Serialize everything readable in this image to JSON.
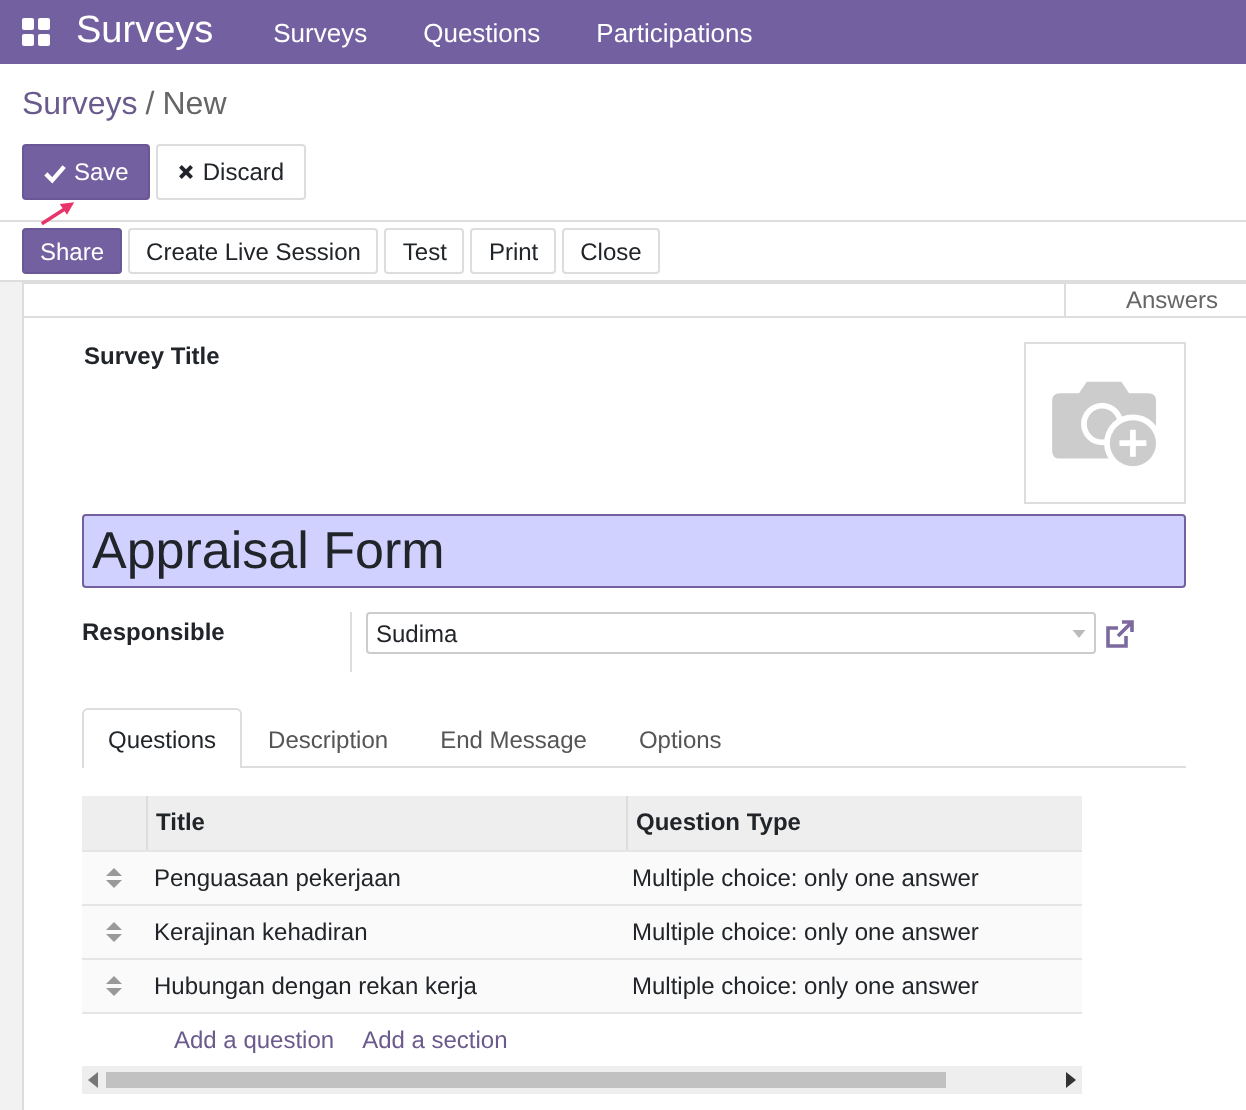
{
  "navbar": {
    "app": "Surveys",
    "menu": [
      {
        "label": "Surveys"
      },
      {
        "label": "Questions"
      },
      {
        "label": "Participations"
      }
    ]
  },
  "breadcrumb": {
    "parent": "Surveys",
    "separator": "/",
    "current": "New"
  },
  "actions": [
    {
      "label": "Save",
      "kind": "primary"
    },
    {
      "label": "Discard",
      "kind": "secondary"
    }
  ],
  "header_buttons": [
    {
      "label": "Share",
      "kind": "primary"
    },
    {
      "label": "Create Live Session",
      "kind": "secondary"
    },
    {
      "label": "Test",
      "kind": "secondary"
    },
    {
      "label": "Print",
      "kind": "secondary"
    },
    {
      "label": "Close",
      "kind": "secondary"
    }
  ],
  "smart_button": {
    "label": "Answers"
  },
  "form": {
    "title_label": "Survey Title",
    "title_value": "Appraisal Form",
    "responsible_label": "Responsible",
    "responsible_value": "Sudima"
  },
  "tabs": [
    {
      "label": "Questions",
      "selected": true
    },
    {
      "label": "Description",
      "selected": false
    },
    {
      "label": "End Message",
      "selected": false
    },
    {
      "label": "Options",
      "selected": false
    }
  ],
  "table": {
    "columns": [
      "Title",
      "Question Type"
    ],
    "rows": [
      {
        "title": "Penguasaan pekerjaan",
        "type": "Multiple choice: only one answer"
      },
      {
        "title": "Kerajinan kehadiran",
        "type": "Multiple choice: only one answer"
      },
      {
        "title": "Hubungan dengan rekan kerja",
        "type": "Multiple choice: only one answer"
      }
    ],
    "links": [
      "Add a question",
      "Add a section"
    ]
  }
}
